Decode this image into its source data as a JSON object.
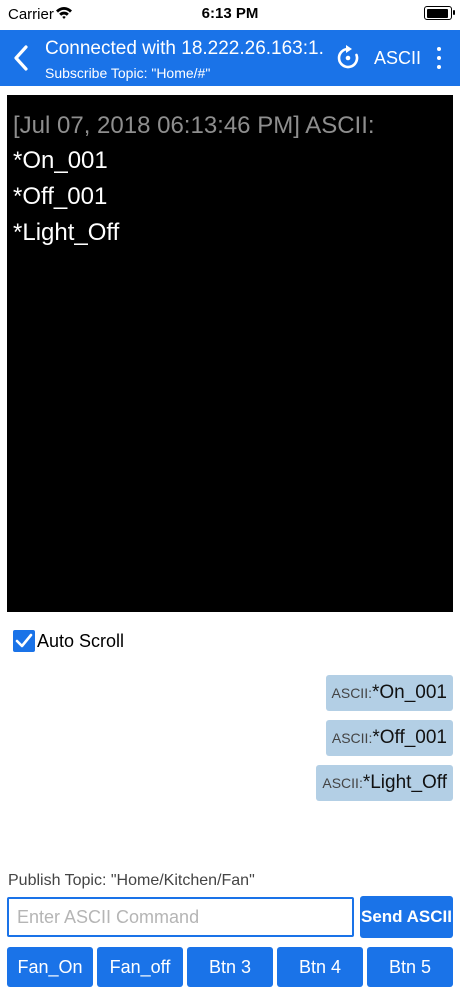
{
  "status_bar": {
    "carrier": "Carrier",
    "time": "6:13 PM",
    "wifi_icon": "wifi-icon",
    "battery_icon": "battery-icon"
  },
  "nav": {
    "title": "Connected with 18.222.26.163:1...",
    "subtitle": "Subscribe Topic: \"Home/#\"",
    "mode_label": "ASCII",
    "back_icon": "chevron-left-icon",
    "refresh_icon": "refresh-icon",
    "more_icon": "more-vertical-icon",
    "color": "#1a73e8"
  },
  "terminal": {
    "header": "[Jul 07, 2018 06:13:46 PM] ASCII:",
    "lines": [
      "*On_001",
      "*Off_001",
      "*Light_Off"
    ],
    "background": "#000000"
  },
  "autoscroll": {
    "label": "Auto Scroll",
    "checked": true
  },
  "history": [
    {
      "prefix": "ASCII:",
      "command": "*On_001"
    },
    {
      "prefix": "ASCII:",
      "command": "*Off_001"
    },
    {
      "prefix": "ASCII:",
      "command": "*Light_Off"
    }
  ],
  "publish": {
    "topic_label": "Publish Topic: \"Home/Kitchen/Fan\"",
    "input_value": "",
    "input_placeholder": "Enter ASCII Command",
    "send_label": "Send ASCII"
  },
  "quick_buttons": [
    {
      "label": "Fan_On"
    },
    {
      "label": "Fan_off"
    },
    {
      "label": "Btn 3"
    },
    {
      "label": "Btn 4"
    },
    {
      "label": "Btn 5"
    }
  ]
}
